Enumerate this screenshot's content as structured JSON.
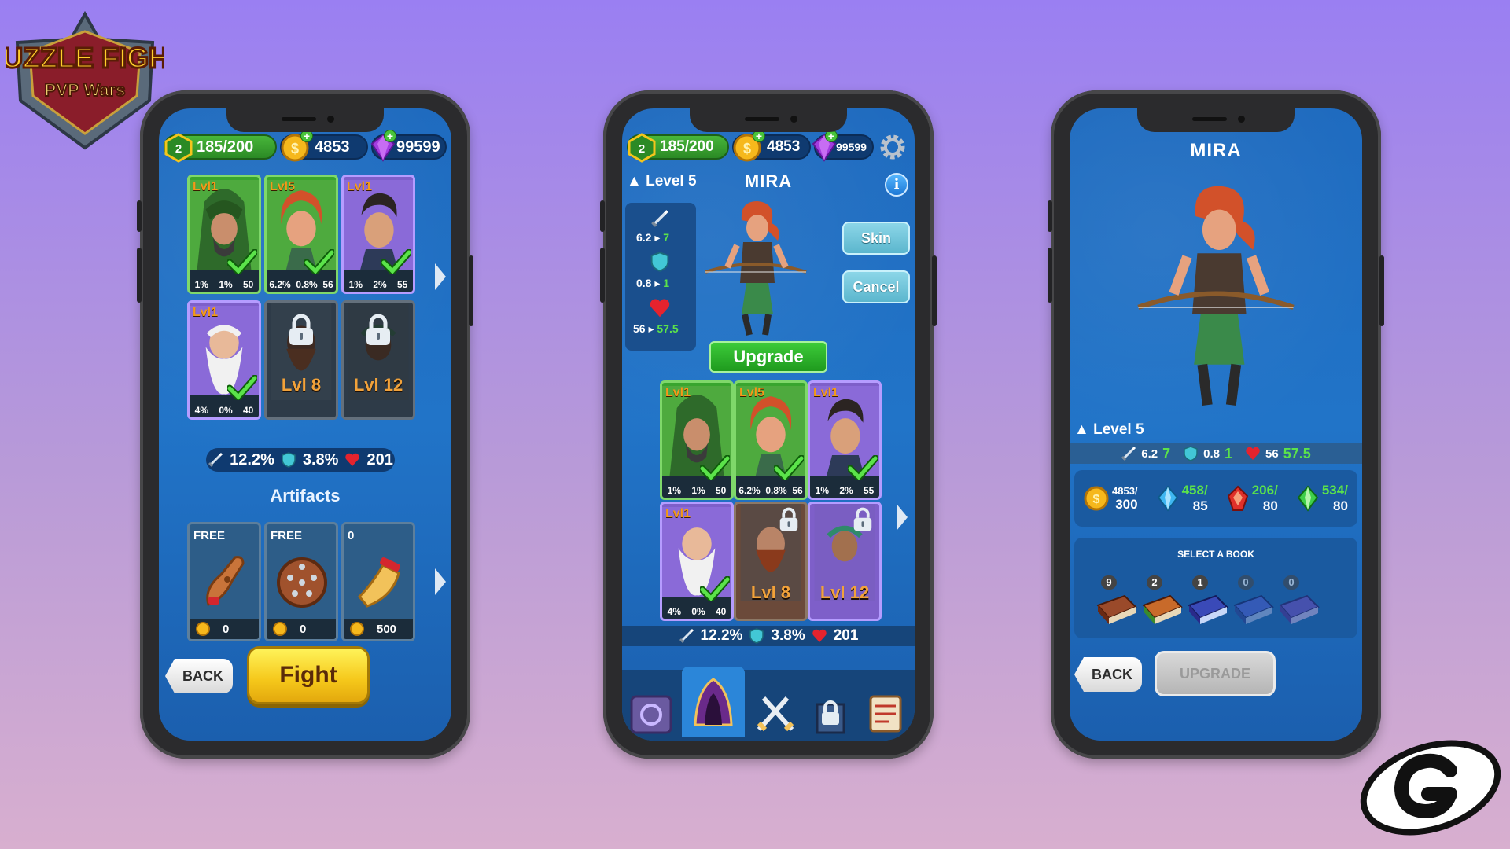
{
  "logo": {
    "line1": "PUZZLE FIGHT",
    "line2": "PVP Wars"
  },
  "common": {
    "energy_level": "2",
    "energy": "185/200",
    "gold": "4853",
    "gems_p1": "99599",
    "gems_p2": "99599"
  },
  "heroes": [
    {
      "level_tag": "Lvl1",
      "stats": [
        "1%",
        "1%",
        "50"
      ],
      "owned": true
    },
    {
      "level_tag": "Lvl5",
      "stats": [
        "6.2%",
        "0.8%",
        "56"
      ],
      "owned": true
    },
    {
      "level_tag": "Lvl1",
      "stats": [
        "1%",
        "2%",
        "55"
      ],
      "owned": true
    },
    {
      "level_tag": "Lvl1",
      "stats": [
        "4%",
        "0%",
        "40"
      ],
      "owned": true
    },
    {
      "level_tag": "Lvl 8",
      "owned": false
    },
    {
      "level_tag": "Lvl 12",
      "owned": false
    }
  ],
  "team_stats": {
    "attack": "12.2%",
    "defense": "3.8%",
    "health": "201"
  },
  "artifacts": {
    "title": "Artifacts",
    "items": [
      {
        "tag": "FREE",
        "cost": "0"
      },
      {
        "tag": "FREE",
        "cost": "0"
      },
      {
        "tag": "0",
        "cost": "500"
      }
    ]
  },
  "phone1": {
    "back_label": "BACK",
    "fight_label": "Fight"
  },
  "phone2": {
    "level": "Level 5",
    "hero_name": "MIRA",
    "info": "i",
    "side_stats": {
      "attack_cur": "6.2",
      "attack_next": "7",
      "defense_cur": "0.8",
      "defense_next": "1",
      "health_cur": "56",
      "health_next": "57.5"
    },
    "skin_label": "Skin",
    "cancel_label": "Cancel",
    "upgrade_label": "Upgrade"
  },
  "phone3": {
    "hero_name": "MIRA",
    "level": "Level 5",
    "stats": {
      "attack_cur": "6.2",
      "attack_next": "7",
      "defense_cur": "0.8",
      "defense_next": "1",
      "health_cur": "56",
      "health_next": "57.5"
    },
    "resources": [
      {
        "have": "4853/",
        "need": "300"
      },
      {
        "have": "458/",
        "need": "85"
      },
      {
        "have": "206/",
        "need": "80"
      },
      {
        "have": "534/",
        "need": "80"
      }
    ],
    "select_book": "SELECT A BOOK",
    "books": [
      "9",
      "2",
      "1",
      "0",
      "0"
    ],
    "back_label": "BACK",
    "upgrade_label": "UPGRADE"
  },
  "colors": {
    "background_top": "#9a7ff2",
    "background_bottom": "#d8afcf",
    "screen_blue": "#2174c8",
    "panel_navy": "#0f3a70",
    "energy_green": "#48b63a",
    "fight_yellow": "#f5c71a",
    "upgrade_green": "#1f9a1e"
  }
}
